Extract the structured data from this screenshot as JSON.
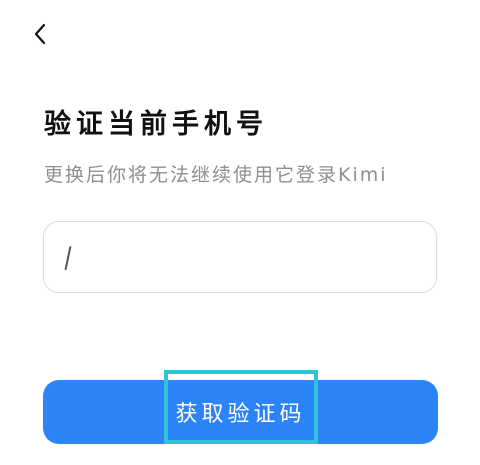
{
  "header": {
    "back_icon": "chevron-left-icon"
  },
  "main": {
    "title": "验证当前手机号",
    "subtitle": "更换后你将无法继续使用它登录Kimi",
    "phone_input": {
      "value": "",
      "placeholder": ""
    },
    "get_code_label": "获取验证码"
  },
  "colors": {
    "primary": "#2b85f8",
    "highlight": "#2ec3d9",
    "subtitle_text": "#8f8f8f"
  }
}
